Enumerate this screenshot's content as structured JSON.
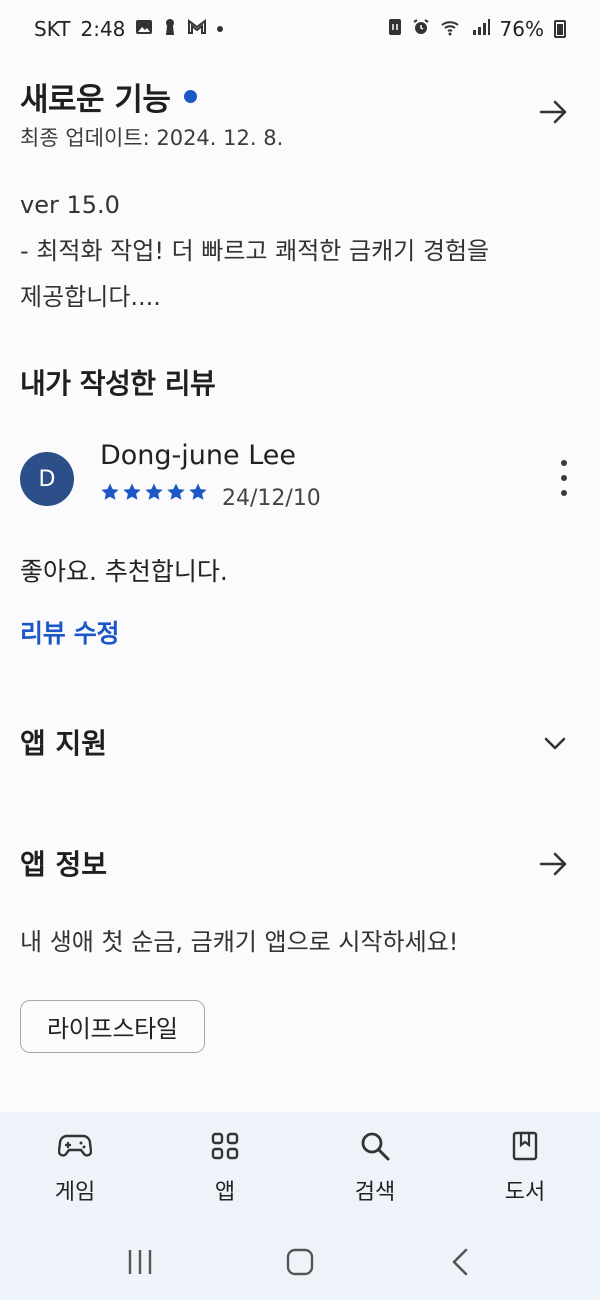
{
  "status_bar": {
    "carrier": "SKT",
    "time": "2:48",
    "battery": "76%"
  },
  "whats_new": {
    "title": "새로운 기능",
    "last_updated": "최종 업데이트: 2024. 12. 8.",
    "notes": [
      "ver 15.0",
      "- 최적화 작업! 더 빠르고 쾌적한 금캐기 경험을",
      "제공합니다...."
    ]
  },
  "my_review": {
    "title": "내가 작성한 리뷰",
    "avatar_letter": "D",
    "reviewer": "Dong-june Lee",
    "rating": 5,
    "date": "24/12/10",
    "text": "좋아요. 추천합니다.",
    "edit_label": "리뷰 수정"
  },
  "app_support": {
    "title": "앱 지원"
  },
  "app_info": {
    "title": "앱 정보",
    "description": "내 생애 첫 순금, 금캐기 앱으로 시작하세요!",
    "category_chip": "라이프스타일"
  },
  "bottom_nav": [
    {
      "label": "게임",
      "icon": "gamepad-icon"
    },
    {
      "label": "앱",
      "icon": "apps-grid-icon"
    },
    {
      "label": "검색",
      "icon": "search-icon"
    },
    {
      "label": "도서",
      "icon": "book-icon"
    }
  ],
  "colors": {
    "accent": "#1b57c7",
    "avatar": "#2c4f8a",
    "nav_background": "#eef2f9"
  }
}
